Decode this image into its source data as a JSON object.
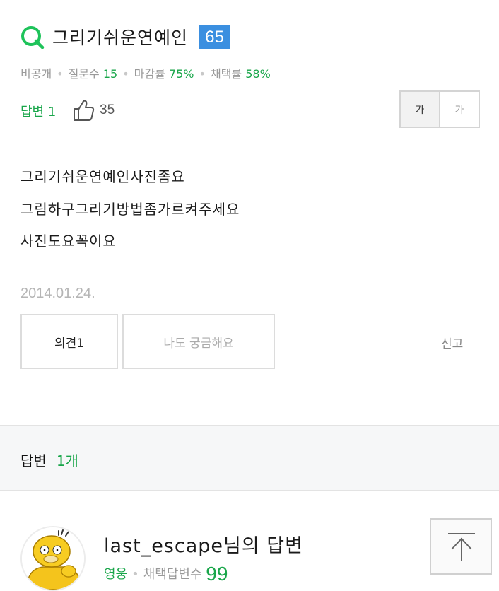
{
  "question": {
    "title": "그리기쉬운연예인",
    "badge": "65",
    "meta": {
      "visibility": "비공개",
      "questions_label": "질문수",
      "questions_value": "15",
      "deadline_label": "마감률",
      "deadline_value": "75%",
      "adoption_label": "채택률",
      "adoption_value": "58%"
    },
    "answers_label": "답변",
    "answers_value": "1",
    "likes": "35",
    "font_size_large": "가",
    "font_size_small": "가",
    "body": [
      "그리기쉬운연예인사진좀요",
      "그림하구그리기방법좀가르켜주세요",
      "사진도요꼭이요"
    ],
    "date": "2014.01.24.",
    "opinion_button": "의견1",
    "curious_button": "나도 궁금해요",
    "report": "신고"
  },
  "answers_header": {
    "label": "답변",
    "count": "1개"
  },
  "answer": {
    "author_line": "last_escape님의 답변",
    "rank": "영웅",
    "adopted_label": "채택답변수",
    "adopted_value": "99"
  },
  "colors": {
    "accent": "#19a64a",
    "badge": "#3b8fe0"
  },
  "icons": {
    "question": "q-icon",
    "like": "thumbs-up-icon",
    "top": "arrow-up-icon"
  }
}
